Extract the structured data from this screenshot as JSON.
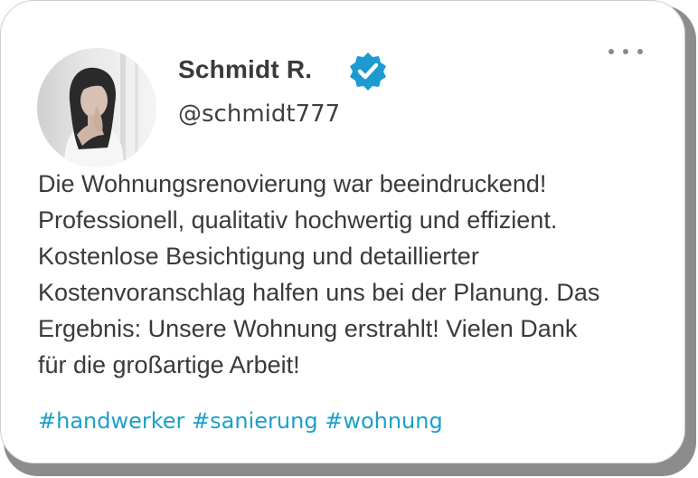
{
  "post": {
    "author": {
      "name": "Schmidt R.",
      "handle": "@schmidt777",
      "verified": true,
      "avatar_icon": "portrait-woman-photo"
    },
    "more_icon": "more-horizontal-icon",
    "body_lines": [
      "Die Wohnungsrenovierung war beeindruckend!",
      "Professionell, qualitativ hochwertig und effizient.",
      "Kostenlose Besichtigung und detaillierter",
      "Kostenvoranschlag halfen uns bei der Planung. Das",
      "Ergebnis: Unsere Wohnung erstrahlt! Vielen Dank",
      "für die großartige Arbeit!"
    ],
    "hashtags": [
      "#handwerker",
      "#sanierung",
      "#wohnung"
    ]
  },
  "colors": {
    "accent": "#1aa0c9",
    "verified_badge": "#1d9bd1",
    "text": "#3a3a3a",
    "card_shadow": "#8c8c8c"
  }
}
